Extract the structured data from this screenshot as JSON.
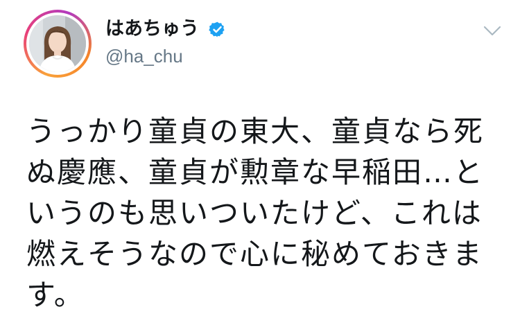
{
  "author": {
    "display_name": "はあちゅう",
    "handle": "@ha_chu",
    "verified": true
  },
  "tweet": {
    "lines": [
      "うっかり童貞の東大、童貞なら死",
      "ぬ慶應、童貞が勲章な早稲田…と",
      "いうのも思いついたけど、これは",
      "燃えそうなので心に秘めておきま",
      "す。"
    ]
  },
  "icons": {
    "verified": "verified-badge-icon",
    "menu": "chevron-down-icon"
  },
  "colors": {
    "text": "#14171a",
    "handle": "#657786",
    "verified": "#1da1f2",
    "chevron": "#aab8c2"
  }
}
